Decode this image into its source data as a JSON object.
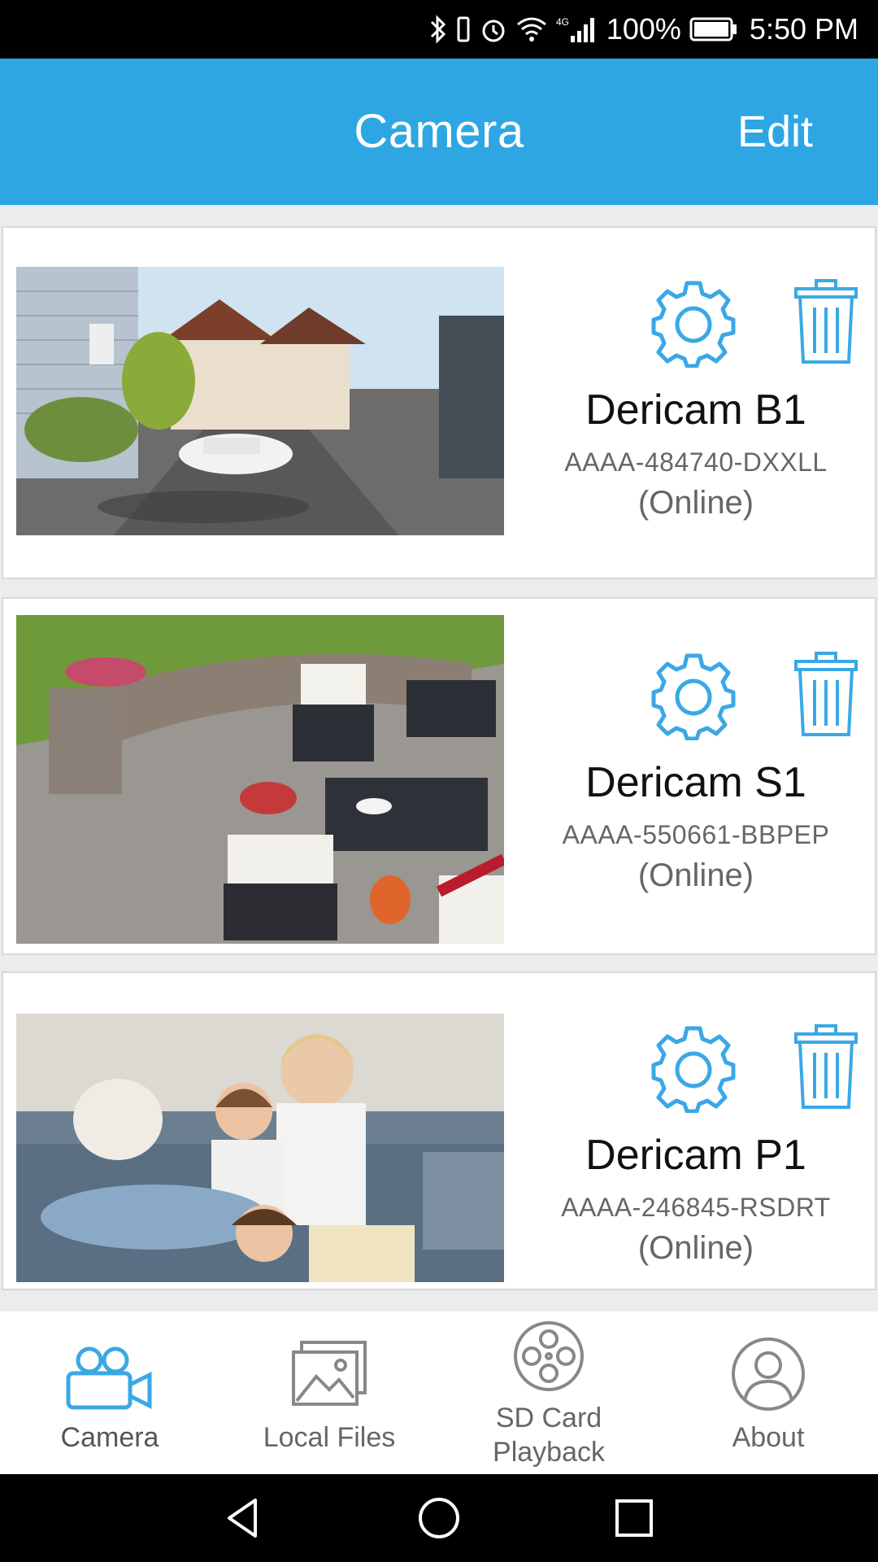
{
  "status_bar": {
    "battery": "100%",
    "time": "5:50 PM",
    "network": "4G",
    "icons": [
      "bluetooth-icon",
      "vibrate-icon",
      "alarm-icon",
      "wifi-icon",
      "signal-icon",
      "battery-icon"
    ]
  },
  "header": {
    "title": "Camera",
    "edit_label": "Edit"
  },
  "cameras": [
    {
      "name": "Dericam B1",
      "id": "AAAA-484740-DXXLL",
      "status": "(Online)",
      "thumbnail": "street-scene"
    },
    {
      "name": "Dericam S1",
      "id": "AAAA-550661-BBPEP",
      "status": "(Online)",
      "thumbnail": "patio-scene"
    },
    {
      "name": "Dericam P1",
      "id": "AAAA-246845-RSDRT",
      "status": "(Online)",
      "thumbnail": "family-scene"
    }
  ],
  "bottom_nav": {
    "items": [
      {
        "label": "Camera",
        "icon": "video-camera-icon",
        "active": true
      },
      {
        "label": "Local Files",
        "icon": "image-icon",
        "active": false
      },
      {
        "label": "SD Card Playback",
        "label_line1": "SD Card",
        "label_line2": "Playback",
        "icon": "film-reel-icon",
        "active": false
      },
      {
        "label": "About",
        "icon": "user-icon",
        "active": false
      }
    ]
  },
  "colors": {
    "accent": "#2ea6e3",
    "icon_blue": "#3aa8e6",
    "text_gray": "#666666"
  }
}
